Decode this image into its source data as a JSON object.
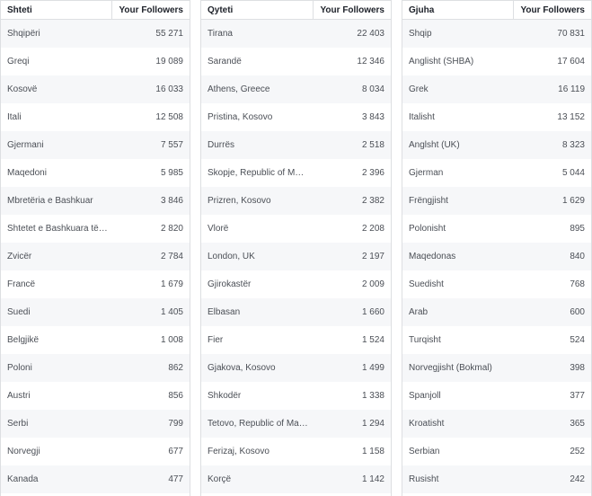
{
  "countries": {
    "col_name": "Shteti",
    "col_value": "Your Followers",
    "rows": [
      {
        "name": "Shqipëri",
        "value": "55 271"
      },
      {
        "name": "Greqi",
        "value": "19 089"
      },
      {
        "name": "Kosovë",
        "value": "16 033"
      },
      {
        "name": "Itali",
        "value": "12 508"
      },
      {
        "name": "Gjermani",
        "value": "7 557"
      },
      {
        "name": "Maqedoni",
        "value": "5 985"
      },
      {
        "name": "Mbretëria e Bashkuar",
        "value": "3 846"
      },
      {
        "name": "Shtetet e Bashkuara të …",
        "value": "2 820"
      },
      {
        "name": "Zvicër",
        "value": "2 784"
      },
      {
        "name": "Francë",
        "value": "1 679"
      },
      {
        "name": "Suedi",
        "value": "1 405"
      },
      {
        "name": "Belgjikë",
        "value": "1 008"
      },
      {
        "name": "Poloni",
        "value": "862"
      },
      {
        "name": "Austri",
        "value": "856"
      },
      {
        "name": "Serbi",
        "value": "799"
      },
      {
        "name": "Norvegji",
        "value": "677"
      },
      {
        "name": "Kanada",
        "value": "477"
      }
    ]
  },
  "cities": {
    "col_name": "Qyteti",
    "col_value": "Your Followers",
    "rows": [
      {
        "name": "Tirana",
        "value": "22 403"
      },
      {
        "name": "Sarandë",
        "value": "12 346"
      },
      {
        "name": "Athens, Greece",
        "value": "8 034"
      },
      {
        "name": "Pristina, Kosovo",
        "value": "3 843"
      },
      {
        "name": "Durrës",
        "value": "2 518"
      },
      {
        "name": "Skopje, Republic of Ma…",
        "value": "2 396"
      },
      {
        "name": "Prizren, Kosovo",
        "value": "2 382"
      },
      {
        "name": "Vlorë",
        "value": "2 208"
      },
      {
        "name": "London, UK",
        "value": "2 197"
      },
      {
        "name": "Gjirokastër",
        "value": "2 009"
      },
      {
        "name": "Elbasan",
        "value": "1 660"
      },
      {
        "name": "Fier",
        "value": "1 524"
      },
      {
        "name": "Gjakova, Kosovo",
        "value": "1 499"
      },
      {
        "name": "Shkodër",
        "value": "1 338"
      },
      {
        "name": "Tetovo, Republic of Ma…",
        "value": "1 294"
      },
      {
        "name": "Ferizaj, Kosovo",
        "value": "1 158"
      },
      {
        "name": "Korçë",
        "value": "1 142"
      }
    ]
  },
  "languages": {
    "col_name": "Gjuha",
    "col_value": "Your Followers",
    "rows": [
      {
        "name": "Shqip",
        "value": "70 831"
      },
      {
        "name": "Anglisht (SHBA)",
        "value": "17 604"
      },
      {
        "name": "Grek",
        "value": "16 119"
      },
      {
        "name": "Italisht",
        "value": "13 152"
      },
      {
        "name": "Anglsht (UK)",
        "value": "8 323"
      },
      {
        "name": "Gjerman",
        "value": "5 044"
      },
      {
        "name": "Frëngjisht",
        "value": "1 629"
      },
      {
        "name": "Polonisht",
        "value": "895"
      },
      {
        "name": "Maqedonas",
        "value": "840"
      },
      {
        "name": "Suedisht",
        "value": "768"
      },
      {
        "name": "Arab",
        "value": "600"
      },
      {
        "name": "Turqisht",
        "value": "524"
      },
      {
        "name": "Norvegjisht (Bokmal)",
        "value": "398"
      },
      {
        "name": "Spanjoll",
        "value": "377"
      },
      {
        "name": "Kroatisht",
        "value": "365"
      },
      {
        "name": "Serbian",
        "value": "252"
      },
      {
        "name": "Rusisht",
        "value": "242"
      }
    ]
  }
}
